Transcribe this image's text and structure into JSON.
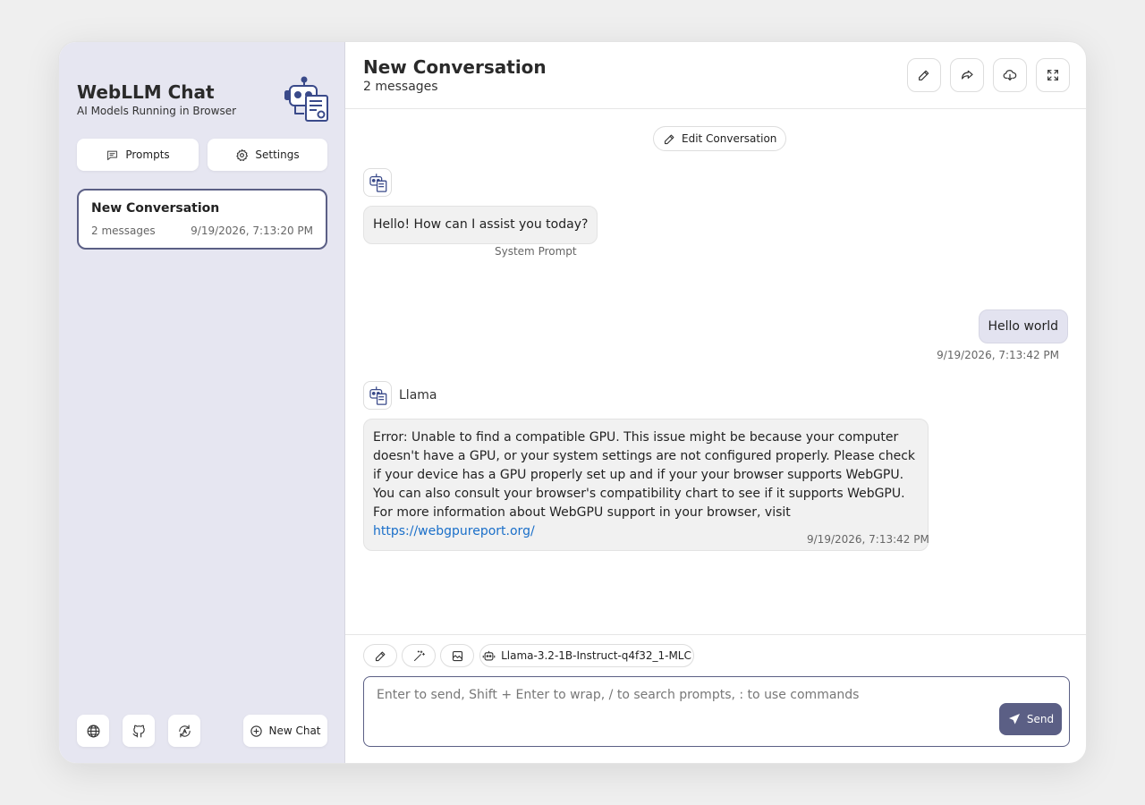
{
  "sidebar": {
    "title": "WebLLM Chat",
    "subtitle": "AI Models Running in Browser",
    "logo_icon": "robot-icon",
    "prompts_label": "Prompts",
    "settings_label": "Settings",
    "conversations": [
      {
        "title": "New Conversation",
        "count": "2 messages",
        "time": "9/19/2026, 7:13:20 PM"
      }
    ],
    "bottom_icons": [
      "globe-icon",
      "github-icon",
      "update-icon"
    ],
    "new_chat_label": "New Chat"
  },
  "header": {
    "title": "New Conversation",
    "subtitle": "2 messages",
    "actions": [
      "edit-icon",
      "share-icon",
      "download-icon",
      "fullscreen-icon"
    ]
  },
  "chat": {
    "edit_conversation_label": "Edit Conversation",
    "messages": [
      {
        "role": "assistant",
        "text": "Hello! How can I assist you today?",
        "meta": "System Prompt"
      },
      {
        "role": "user",
        "text": "Hello world",
        "meta": "9/19/2026, 7:13:42 PM"
      },
      {
        "role": "assistant",
        "speaker": "Llama",
        "text": "Error: Unable to find a compatible GPU. This issue might be because your computer doesn't have a GPU, or your system settings are not configured properly. Please check if your device has a GPU properly set up and if your your browser supports WebGPU. You can also consult your browser's compatibility chart to see if it supports WebGPU. For more information about WebGPU support in your browser, visit",
        "link": "https://webgpureport.org/",
        "meta": "9/19/2026, 7:13:42 PM"
      }
    ]
  },
  "input": {
    "model_label": "Llama-3.2-1B-Instruct-q4f32_1-MLC",
    "placeholder": "Enter to send, Shift + Enter to wrap, / to search prompts, : to use commands",
    "send_label": "Send"
  },
  "colors": {
    "accent": "#5b5f85",
    "sidebar_bg": "#e6e6f1",
    "link": "#1a6fc9"
  }
}
